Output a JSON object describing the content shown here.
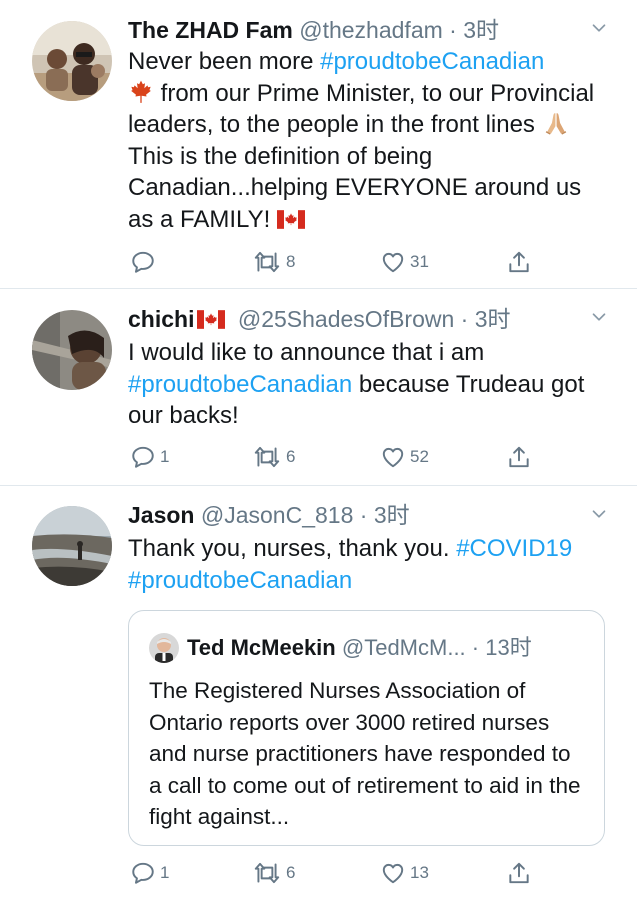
{
  "tweets": [
    {
      "name": "The ZHAD Fam",
      "handle": "@thezhadfam",
      "sep": "·",
      "time": "3时",
      "text": {
        "t1": "Never been more ",
        "tag1": "#proudtobeCanadian",
        "t2": " from our Prime Minister, to our Provincial leaders, to the people in the front lines ",
        "t3": " This is the definition of being Canadian...helping EVERYONE around us as a FAMILY! "
      },
      "actions": {
        "reply": "",
        "retweet": "8",
        "like": "31"
      }
    },
    {
      "name": "chichi",
      "handle": "@25ShadesOfBrown",
      "sep": "·",
      "time": "3时",
      "text": {
        "t1": "I would like to announce that i am ",
        "tag1": "#proudtobeCanadian",
        "t2": " because Trudeau got our backs!"
      },
      "actions": {
        "reply": "1",
        "retweet": "6",
        "like": "52"
      }
    },
    {
      "name": "Jason",
      "handle": "@JasonC_818",
      "sep": "·",
      "time": "3时",
      "text": {
        "t1": "Thank you, nurses, thank you. ",
        "tag1": "#COVID19",
        "tag2": "#proudtobeCanadian"
      },
      "quote": {
        "name": "Ted McMeekin",
        "handle": "@TedMcM...",
        "sep": "·",
        "time": "13时",
        "text": "The Registered Nurses Association of Ontario reports over 3000 retired nurses and nurse practitioners have responded to a call to come out of retirement to aid in the fight against..."
      },
      "actions": {
        "reply": "1",
        "retweet": "6",
        "like": "13"
      }
    }
  ],
  "icons": {
    "reply": "reply-icon",
    "retweet": "retweet-icon",
    "like": "like-icon",
    "share": "share-icon",
    "more": "chevron-down-icon",
    "maple_leaf": "maple-leaf-emoji",
    "praying_hands": "praying-hands-emoji",
    "canada_flag": "canada-flag-emoji"
  },
  "colors": {
    "hashtag": "#1da1f2",
    "secondary_text": "#657786",
    "divider": "#e1e8ed",
    "primary_text": "#14171a"
  }
}
